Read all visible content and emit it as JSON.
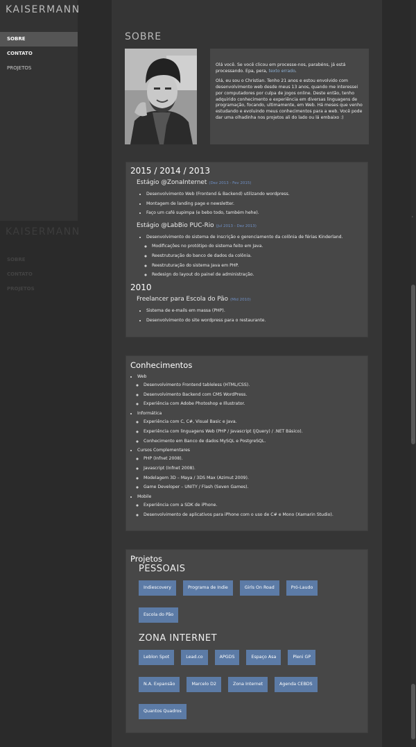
{
  "sidebar": {
    "brand": "KAISERMANN",
    "items": [
      {
        "label": "SOBRE"
      },
      {
        "label": "CONTATO"
      },
      {
        "label": "PROJETOS"
      }
    ]
  },
  "ghost_sidebar": {
    "brand": "KAISERMANN",
    "items": [
      {
        "label": "SOBRE"
      },
      {
        "label": "CONTATO"
      },
      {
        "label": "PROJETOS"
      }
    ]
  },
  "about": {
    "title": "SOBRE",
    "para1_a": "Olá você. Se você clicou em processe-nos, parabéns, já está processando. Epa, pera, ",
    "para1_link": "texto errado",
    "para1_b": ".",
    "para2": "Olá, eu sou o Christian. Tenho 21 anos e estou envolvido com desenvolvimento web desde meus 13 anos, quando me interessei por computadores por culpa de jogos online. Deste então, tenho adquirido conhecimento e experiência em diversas linguagens de programação, focando, ultimamente, em Web. Há meses que venho estudando e evoluindo meus conhecimentos para a web. Você pode dar uma olhadinha nos projetos ali do lado ou lá embaixo :)"
  },
  "experience": {
    "year1": "2015 / 2014 / 2013",
    "job1": {
      "title": "Estágio @ZonaInternet",
      "date": "(Dez 2013 - Fev 2015)",
      "items": [
        "Desenvolvimento Web (Frontend & Backend) utilizando wordpress.",
        "Montagem de landing page e newsletter.",
        "Faço um café supimpa (e bebo todo, também hehe)."
      ]
    },
    "job2": {
      "title": "Estágio @LabBio PUC-Rio",
      "date": "(Jul 2013 - Dez 2013)",
      "item": "Desenvolvimento do sistema de inscrição e gerenciamento da colônia de férias Kinderland.",
      "subitems": [
        "Modificações no protótipo do sistema feito em Java.",
        "Reestruturação do banco de dados da colônia.",
        "Reestruturação do sistema Java em PHP.",
        "Redesign do layout do painel de administração."
      ]
    },
    "year2": "2010",
    "job3": {
      "title": "Freelancer para Escola do Pão",
      "date": "(Mid 2010)",
      "items": [
        "Sistema de e-mails em massa (PHP).",
        "Desenvolvimento do site wordpress para o restaurante."
      ]
    }
  },
  "skills": {
    "title": "Conhecimentos",
    "groups": [
      {
        "name": "Web",
        "items": [
          "Desenvolvimento Frontend tableless (HTML/CSS).",
          "Desenvolvimento Backend com CMS WordPress.",
          "Experiência com Adobe Photoshop e Illustrator."
        ]
      },
      {
        "name": "Informática",
        "items": [
          "Experiência com C, C#, Visual Basic e Java.",
          "Experiência com linguagens Web (PHP / Javascript (jQuery) / .NET Básico).",
          "Conhecimento em Banco de dados MySQL e PostgreSQL."
        ]
      },
      {
        "name": "Cursos Complementares",
        "items": [
          "PHP (Infnet 2008).",
          "Javascript (Infnet 2008).",
          "Modelagem 3D – Maya / 3DS Max (Azimut 2009).",
          "Game Developer – UNITY / Flash (Seven Games)."
        ]
      },
      {
        "name": "Mobile",
        "items": [
          "Experiência com a SDK de iPhone.",
          "Desenvolvimento de aplicativos para iPhone com o uso de C# e Mono (Xamarin Studio)."
        ]
      }
    ]
  },
  "projects": {
    "title": "Projetos",
    "personal_title": "PESSOAIS",
    "personal": [
      "Indiescovery",
      "Programa de Indie",
      "Girls On Road",
      "Pró-Laudo",
      "Escola do Pão"
    ],
    "zona_title": "ZONA INTERNET",
    "zona": [
      "Leblon Spot",
      "Lead.co",
      "APGDS",
      "Espaço Asa",
      "Pleni GP",
      "N.A. Expansão",
      "Marcelo D2",
      "Zona Internet",
      "Agenda CEBDS",
      "Quantos Quadros"
    ]
  },
  "colors": {
    "accent_button": "#5c7ba6",
    "link": "#8fb2d6",
    "date": "#6f8fc4"
  }
}
